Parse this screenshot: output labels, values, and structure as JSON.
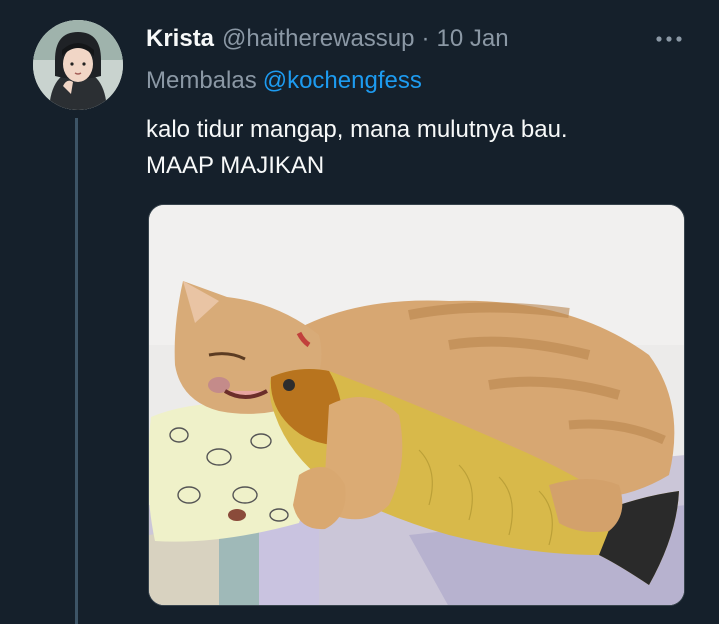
{
  "tweet": {
    "author_name": "Krista",
    "author_handle": "@haitherewassup",
    "separator": "·",
    "date": "10 Jan",
    "replying_label": "Membalas",
    "replying_to": "@kochengfess",
    "text_line1": "kalo tidur mangap, mana mulutnya bau.",
    "text_line2": "MAAP MAJIKAN",
    "avatar_icon": "user-avatar",
    "more_icon": "more-horizontal-icon",
    "media_description_icon": "photo"
  },
  "colors": {
    "background": "#15202b",
    "primary_text": "#f7f9f9",
    "secondary_text": "#8b98a5",
    "link": "#1d9bf0",
    "thread_line": "#3d5466"
  }
}
